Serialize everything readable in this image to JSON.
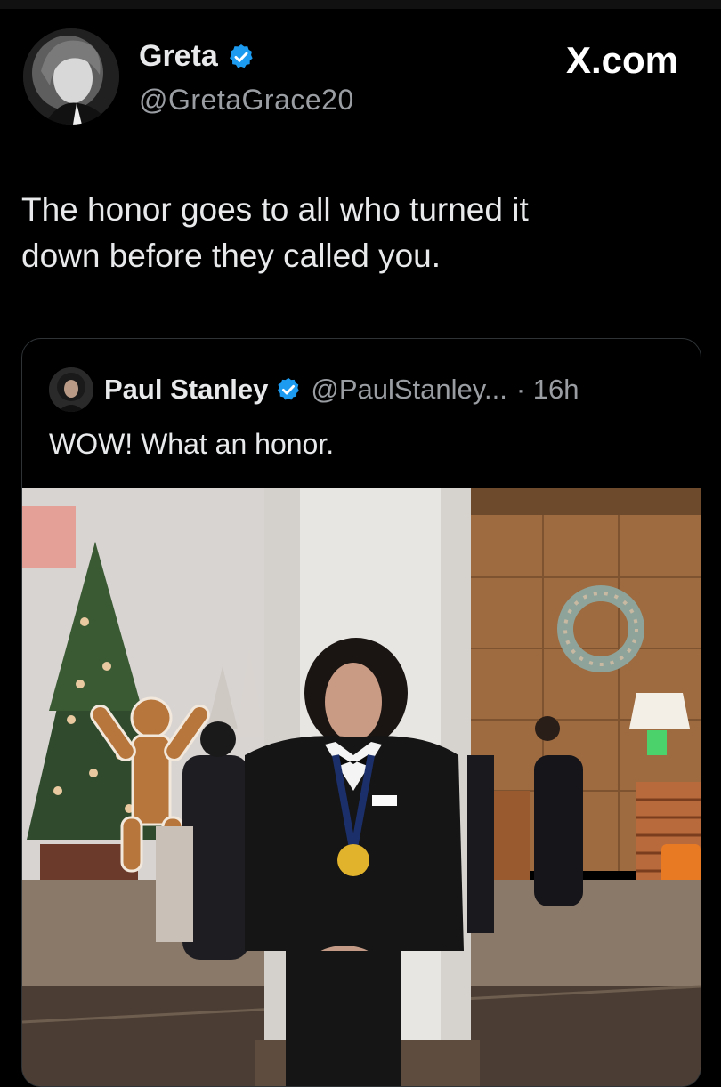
{
  "post": {
    "author_name": "Greta",
    "author_handle": "@GretaGrace20",
    "brand": "X.com",
    "text_line1": "The honor goes to all who turned it",
    "text_line2": "down before they called you."
  },
  "quoted": {
    "author_name": "Paul Stanley",
    "author_handle": "@PaulStanley...",
    "time": "· 16h",
    "text": "WOW! What an honor."
  },
  "colors": {
    "background": "#000000",
    "text": "#e7e9ea",
    "secondary_text": "#9a9ea3",
    "verified": "#1d9bf0",
    "border": "#2f3336"
  },
  "icons": [
    "verified-badge-icon",
    "x-logo"
  ]
}
